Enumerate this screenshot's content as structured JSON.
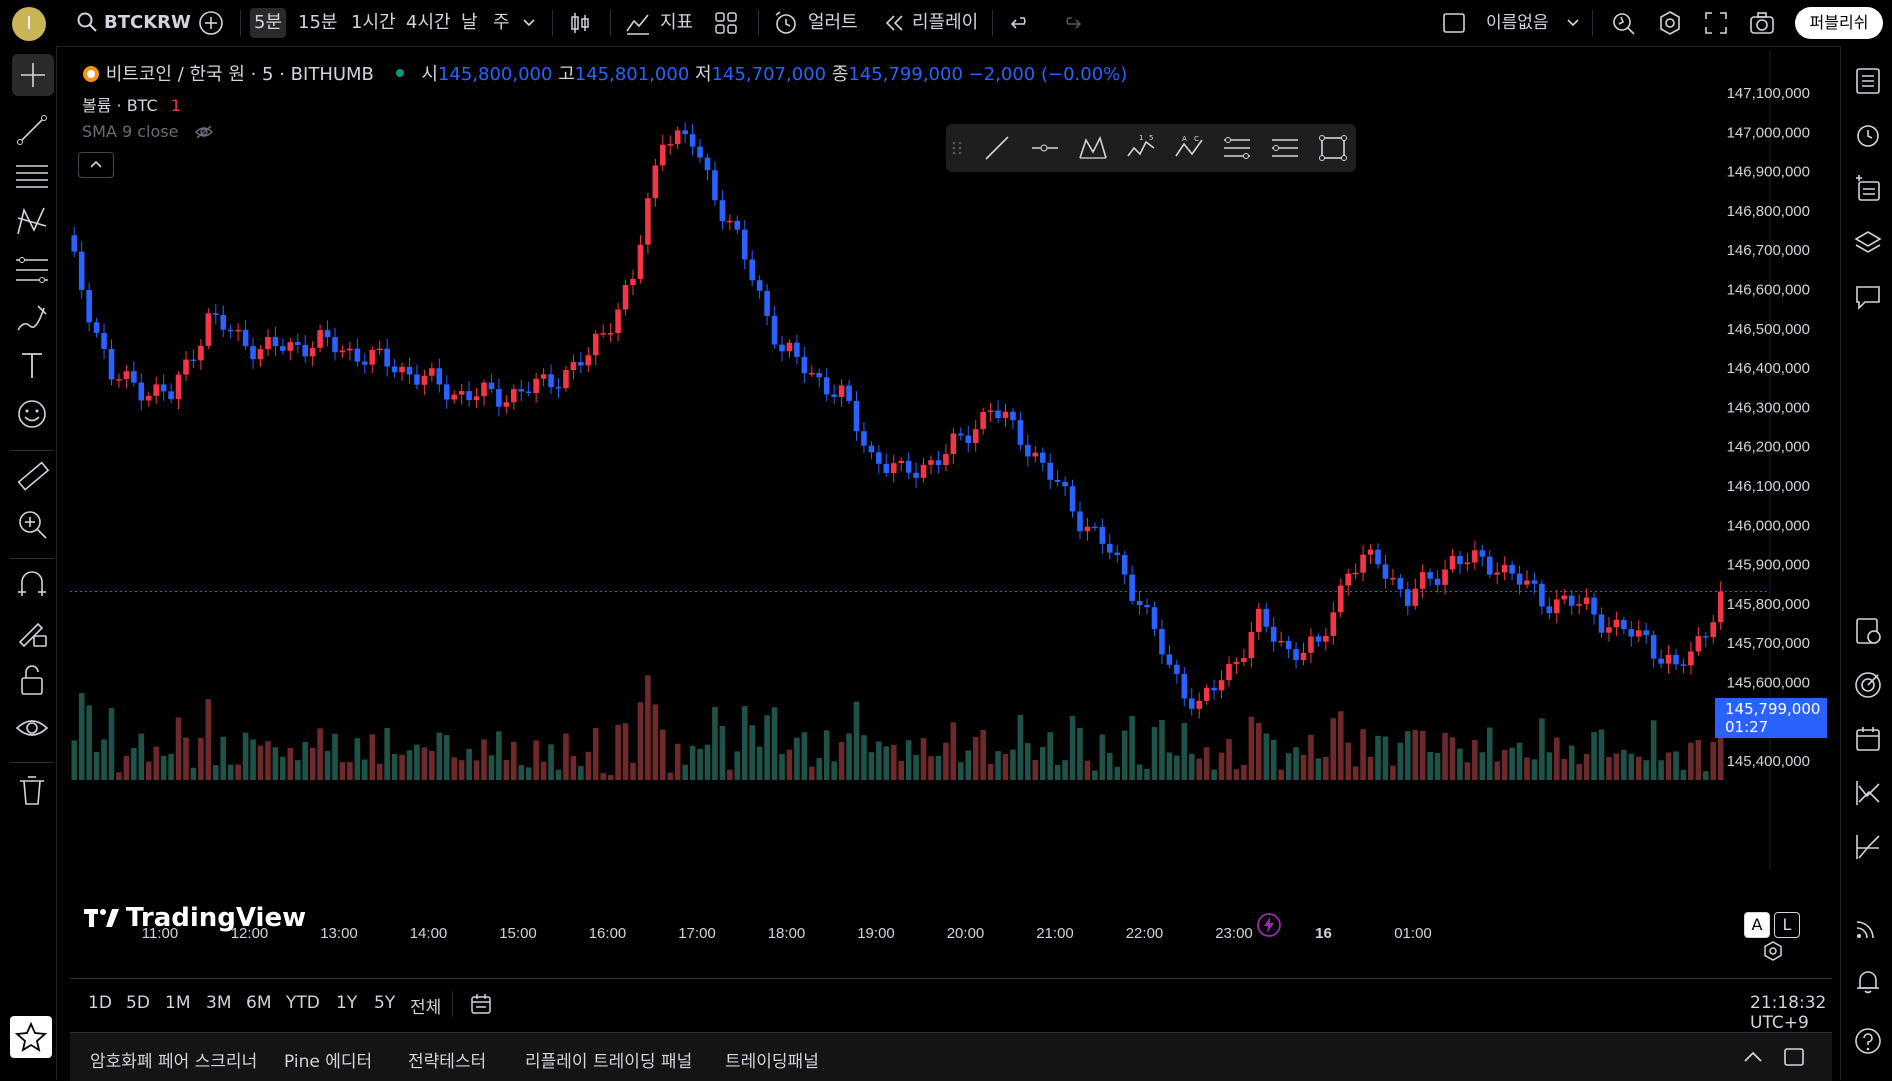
{
  "topbar": {
    "avatar_letter": "I",
    "symbol": "BTCKRW",
    "intervals": [
      "5분",
      "15분",
      "1시간",
      "4시간",
      "날",
      "주"
    ],
    "active_interval": "5분",
    "indicators_label": "지표",
    "alert_label": "얼러트",
    "replay_label": "리플레이",
    "layout_name": "이름없음",
    "publish_label": "퍼블리쉬"
  },
  "legend": {
    "symbol_name": "비트코인 / 한국 원 · 5 · BITHUMB",
    "open_label": "시",
    "open": "145,800,000",
    "high_label": "고",
    "high": "145,801,000",
    "low_label": "저",
    "low": "145,707,000",
    "close_label": "종",
    "close": "145,799,000",
    "change": "−2,000 (−0.00%)",
    "volume_label": "볼륨 · BTC",
    "volume_value": "1",
    "sma_label": "SMA 9 close"
  },
  "price_badge": {
    "price": "145,799,000",
    "countdown": "01:27"
  },
  "branding": {
    "logo_text": "TradingView"
  },
  "alert_buttons": [
    "A",
    "L"
  ],
  "colors": {
    "up": "#f23645",
    "down": "#2962ff",
    "vol_up": "#6e2a2a",
    "vol_down": "#1f5248",
    "accent": "#2962ff"
  },
  "chart_data": {
    "type": "candlestick",
    "x_labels": [
      "11:00",
      "12:00",
      "13:00",
      "14:00",
      "15:00",
      "16:00",
      "17:00",
      "18:00",
      "19:00",
      "20:00",
      "21:00",
      "22:00",
      "23:00",
      "16",
      "01:00"
    ],
    "y_labels": [
      "147,100,000",
      "147,000,000",
      "146,900,000",
      "146,800,000",
      "146,700,000",
      "146,600,000",
      "146,500,000",
      "146,400,000",
      "146,300,000",
      "146,200,000",
      "146,100,000",
      "146,000,000",
      "145,900,000",
      "145,800,000",
      "145,700,000",
      "145,600,000",
      "145,500,000",
      "145,400,000"
    ],
    "ylim": [
      145340000,
      147140000
    ],
    "last_price": 145799000,
    "candle_anchors": [
      [
        0,
        146700000
      ],
      [
        6,
        146350000
      ],
      [
        14,
        146300000
      ],
      [
        19,
        146500000
      ],
      [
        26,
        146420000
      ],
      [
        34,
        146440000
      ],
      [
        44,
        146380000
      ],
      [
        52,
        146310000
      ],
      [
        58,
        146300000
      ],
      [
        64,
        146330000
      ],
      [
        70,
        146400000
      ],
      [
        76,
        146600000
      ],
      [
        80,
        146980000
      ],
      [
        84,
        146950000
      ],
      [
        90,
        146700000
      ],
      [
        96,
        146420000
      ],
      [
        100,
        146360000
      ],
      [
        104,
        146300000
      ],
      [
        108,
        146150000
      ],
      [
        112,
        146100000
      ],
      [
        118,
        146150000
      ],
      [
        124,
        146270000
      ],
      [
        128,
        146200000
      ],
      [
        136,
        145990000
      ],
      [
        140,
        145900000
      ],
      [
        144,
        145780000
      ],
      [
        148,
        145600000
      ],
      [
        152,
        145500000
      ],
      [
        156,
        145600000
      ],
      [
        160,
        145720000
      ],
      [
        164,
        145650000
      ],
      [
        168,
        145650000
      ],
      [
        172,
        145860000
      ],
      [
        176,
        145880000
      ],
      [
        180,
        145780000
      ],
      [
        186,
        145880000
      ],
      [
        192,
        145870000
      ],
      [
        198,
        145780000
      ],
      [
        204,
        145760000
      ],
      [
        208,
        145700000
      ],
      [
        212,
        145680000
      ],
      [
        216,
        145590000
      ],
      [
        220,
        145700000
      ],
      [
        222,
        145799000
      ]
    ]
  },
  "range_buttons": [
    "1D",
    "5D",
    "1M",
    "3M",
    "6M",
    "YTD",
    "1Y",
    "5Y",
    "전체"
  ],
  "clock": "21:18:32 UTC+9",
  "bottom_panels": [
    "암호화폐 페어 스크리너",
    "Pine 에디터",
    "전략테스터",
    "리플레이 트레이딩 패널",
    "트레이딩패널"
  ]
}
